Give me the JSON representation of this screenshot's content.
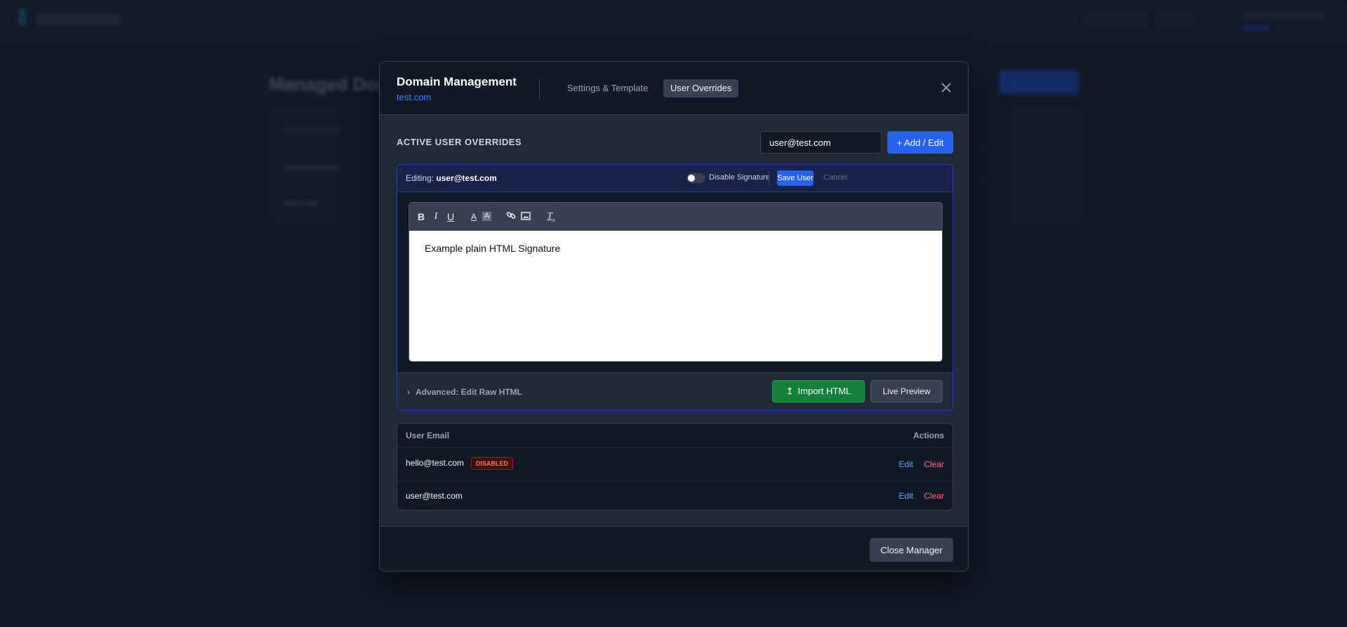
{
  "background": {
    "page_title": "Managed Domains",
    "domains": [
      "test.com"
    ]
  },
  "modal": {
    "title": "Domain Management",
    "domain": "test.com",
    "tabs": [
      {
        "label": "Settings & Template",
        "active": false
      },
      {
        "label": "User Overrides",
        "active": true
      }
    ],
    "section_title": "ACTIVE USER OVERRIDES",
    "email_input": {
      "value": "user@test.com"
    },
    "add_edit_label": "+ Add / Edit",
    "editor": {
      "editing_prefix": "Editing:",
      "editing_email": "user@test.com",
      "disable_signature_label": "Disable Signature",
      "disable_signature_on": false,
      "save_label": "Save User",
      "cancel_label": "Cancel",
      "toolbar": [
        "bold-icon",
        "italic-icon",
        "underline-icon",
        "text-color-icon",
        "highlight-icon",
        "link-icon",
        "image-icon",
        "clear-format-icon"
      ],
      "content": "Example plain HTML Signature",
      "advanced_label": "Advanced: Edit Raw HTML",
      "import_label": "Import HTML",
      "preview_label": "Live Preview"
    },
    "table": {
      "headers": [
        "User Email",
        "Actions"
      ],
      "rows": [
        {
          "email": "hello@test.com",
          "badge": "DISABLED",
          "edit": "Edit",
          "clear": "Clear"
        },
        {
          "email": "user@test.com",
          "edit": "Edit",
          "clear": "Clear"
        }
      ]
    },
    "close_label": "Close Manager"
  },
  "colors": {
    "accent": "#2563eb",
    "success": "#15803d",
    "danger": "#f87171",
    "link": "#60a5fa"
  }
}
